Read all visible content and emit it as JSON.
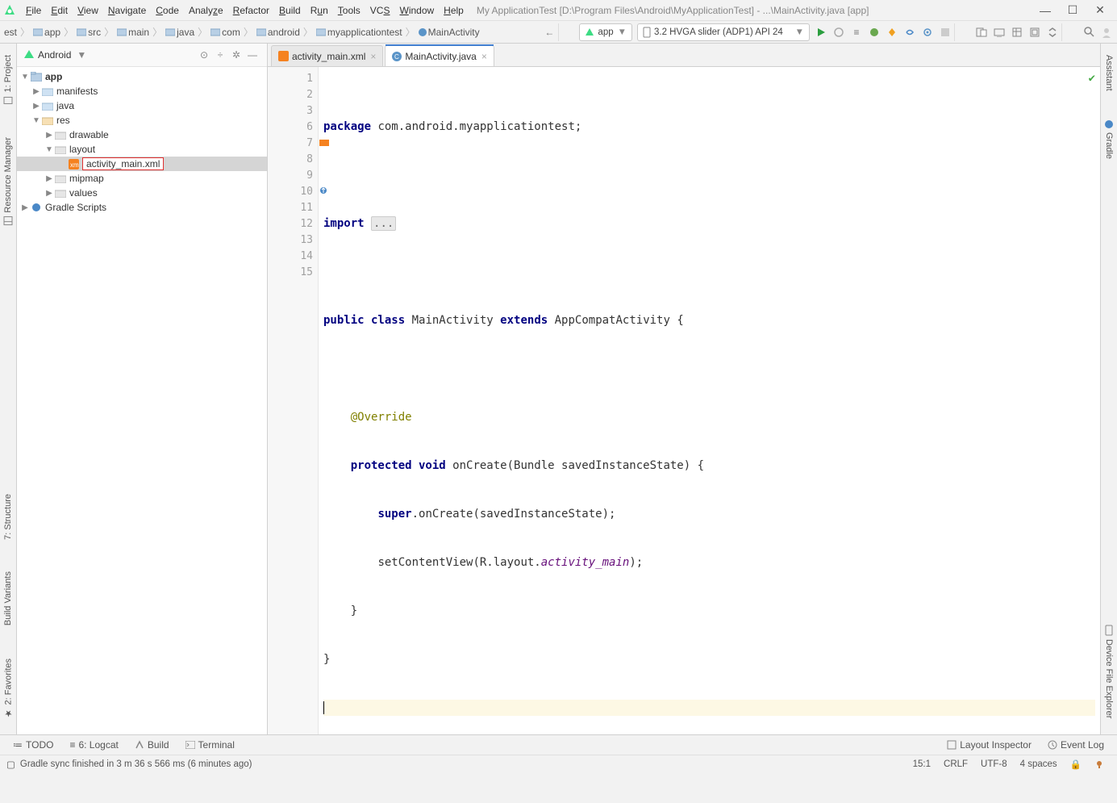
{
  "menu": {
    "items": [
      "File",
      "Edit",
      "View",
      "Navigate",
      "Code",
      "Analyze",
      "Refactor",
      "Build",
      "Run",
      "Tools",
      "VCS",
      "Window",
      "Help"
    ],
    "title": "My ApplicationTest [D:\\Program Files\\Android\\MyApplicationTest] - ...\\MainActivity.java [app]"
  },
  "crumbs": {
    "items": [
      "est",
      "app",
      "src",
      "main",
      "java",
      "com",
      "android",
      "myapplicationtest",
      "MainActivity"
    ]
  },
  "toolbar": {
    "runconfig": "app",
    "device": "3.2  HVGA slider (ADP1) API 24"
  },
  "projpane": {
    "mode": "Android"
  },
  "tree": {
    "app": "app",
    "manifests": "manifests",
    "java": "java",
    "res": "res",
    "drawable": "drawable",
    "layout": "layout",
    "activity_main": "activity_main.xml",
    "mipmap": "mipmap",
    "values": "values",
    "gradle": "Gradle Scripts"
  },
  "tabs": {
    "t1": "activity_main.xml",
    "t2": "MainActivity.java"
  },
  "codeLines": {
    "l1a": "package",
    "l1b": " com.android.myapplicationtest;",
    "l3a": "import ",
    "l3b": "...",
    "l7a": "public class",
    "l7b": " MainActivity ",
    "l7c": "extends",
    "l7d": " AppCompatActivity {",
    "l9a": "@Override",
    "l10a": "protected void",
    "l10b": " onCreate(Bundle savedInstanceState) {",
    "l11a": "super",
    "l11b": ".onCreate(savedInstanceState);",
    "l12a": "setContentView(R.layout.",
    "l12b": "activity_main",
    "l12c": ");",
    "l13": "    }",
    "l14": "}"
  },
  "lineNumbers": [
    "1",
    "2",
    "3",
    "6",
    "7",
    "8",
    "9",
    "10",
    "11",
    "12",
    "13",
    "14",
    "15"
  ],
  "leftTabs": {
    "project": "1: Project",
    "resmgr": "Resource Manager",
    "structure": "7: Structure",
    "bv": "Build Variants",
    "fav": "2: Favorites"
  },
  "rightTabs": {
    "assistant": "Assistant",
    "gradle": "Gradle",
    "dfe": "Device File Explorer"
  },
  "bottom": {
    "todo": "TODO",
    "logcat": "6: Logcat",
    "build": "Build",
    "terminal": "Terminal",
    "li": "Layout Inspector",
    "el": "Event Log"
  },
  "status": {
    "msg": "Gradle sync finished in 3 m 36 s 566 ms (6 minutes ago)",
    "pos": "15:1",
    "eol": "CRLF",
    "enc": "UTF-8",
    "indent": "4 spaces"
  }
}
